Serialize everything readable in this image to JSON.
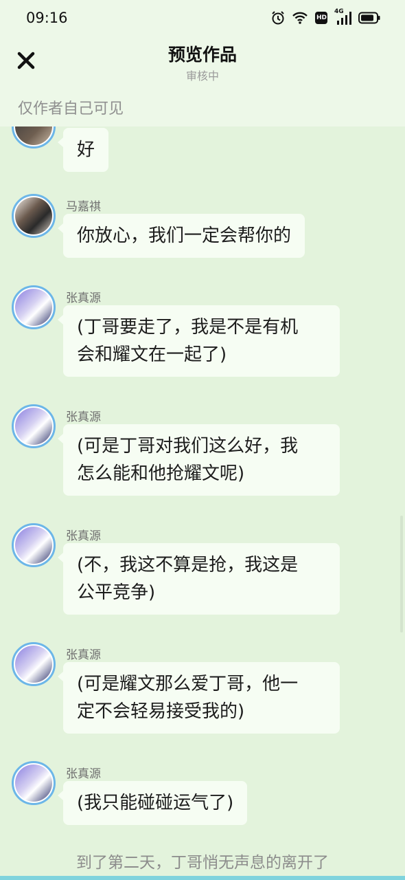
{
  "status_bar": {
    "time": "09:16",
    "icons": [
      "alarm-icon",
      "wifi-icon",
      "hd-icon",
      "signal-4g-icon",
      "battery-icon"
    ],
    "network_label": "4G",
    "hd_label": "HD"
  },
  "header": {
    "close_icon": "close-icon",
    "title": "预览作品",
    "subtitle": "审核中",
    "visibility_note": "仅作者自己可见"
  },
  "messages": [
    {
      "sender": "",
      "text": "好",
      "avatar": "avatar-dark"
    },
    {
      "sender": "马嘉祺",
      "text": "你放心，我们一定会帮你的",
      "avatar": "avatar-ma"
    },
    {
      "sender": "张真源",
      "lines": [
        "(丁哥要走了，我是不是有机",
        "会和耀文在一起了)"
      ],
      "avatar": "avatar-zhang"
    },
    {
      "sender": "张真源",
      "lines": [
        "(可是丁哥对我们这么好，我",
        "怎么能和他抢耀文呢)"
      ],
      "avatar": "avatar-zhang"
    },
    {
      "sender": "张真源",
      "lines": [
        "(不，我这不算是抢，我这是",
        "公平竞争)"
      ],
      "avatar": "avatar-zhang"
    },
    {
      "sender": "张真源",
      "lines": [
        "(可是耀文那么爱丁哥，他一",
        "定不会轻易接受我的)"
      ],
      "avatar": "avatar-zhang"
    },
    {
      "sender": "张真源",
      "text": "(我只能碰碰运气了)",
      "avatar": "avatar-zhang"
    }
  ],
  "narration": "到了第二天，丁哥悄无声息的离开了",
  "colors": {
    "background": "#e3f3dc",
    "bubble": "#f6fdf3",
    "avatar_ring": "#6cb6e8"
  }
}
